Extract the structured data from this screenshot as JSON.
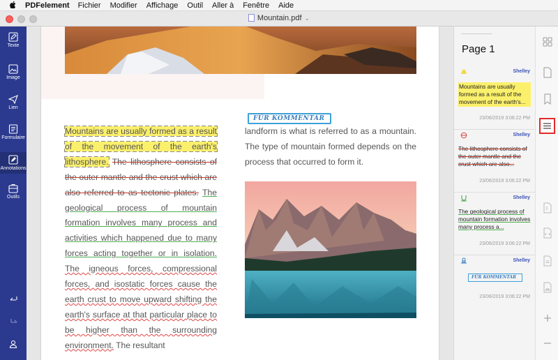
{
  "menubar": {
    "apple": "",
    "app_name": "PDFelement",
    "items": [
      "Fichier",
      "Modifier",
      "Affichage",
      "Outil",
      "Aller à",
      "Fenêtre",
      "Aide"
    ]
  },
  "window": {
    "title": "Mountain.pdf"
  },
  "leftbar": {
    "tools": [
      {
        "label": "Texte"
      },
      {
        "label": "Image"
      },
      {
        "label": "Lien"
      },
      {
        "label": "Formulaire"
      },
      {
        "label": "Annotations"
      },
      {
        "label": "Outils"
      }
    ]
  },
  "document": {
    "left_column": {
      "highlighted": "Mountains are usually formed as a result of the movement of the earth's lithosphere.",
      "struck": "The lithosphere consists of the outer mantle and the crust which are also referred to as tectonic plates.",
      "underlined": "The geological process of mountain formation involves many process and activities which happened due to many forces acting together or in isolation.",
      "plain_1": "The igneous forces, compressional forces, and isostatic forces cause the earth crust to move upward shifting the earth's surface at that particular place to be higher than the surrounding environment.",
      "plain_2": "The resultant"
    },
    "right_column": {
      "text": "landform is what is referred to as a mountain. The type of mountain formed depends on the process that occurred to form it."
    },
    "stamp_text": "FÜR KOMMENTAR"
  },
  "comments_panel": {
    "page_header": "Page 1",
    "notes": [
      {
        "type": "highlight",
        "author": "Shelley",
        "text": "Mountains are usually formed as a result of the movement of the earth's...",
        "date": "23/06/2019 3:06:22 PM"
      },
      {
        "type": "strikethrough",
        "author": "Shelley",
        "text": "The lithosphere consists of the outer mantle and the crust which are also...",
        "date": "23/06/2019 3:06:22 PM"
      },
      {
        "type": "underline",
        "author": "Shelley",
        "text": "The geological process of mountain formation involves many process a...",
        "date": "23/06/2019 3:06:22 PM"
      },
      {
        "type": "stamp",
        "author": "Shelley",
        "text": "FÜR KOMMENTAR",
        "date": "23/06/2019 3:06:22 PM"
      }
    ]
  },
  "colors": {
    "sidebar": "#2b3a8f",
    "highlight": "#fbf06c",
    "strike": "#c0392b",
    "underline": "#4caf50",
    "author": "#3b51b8",
    "selected_outline": "#e02a2a"
  }
}
